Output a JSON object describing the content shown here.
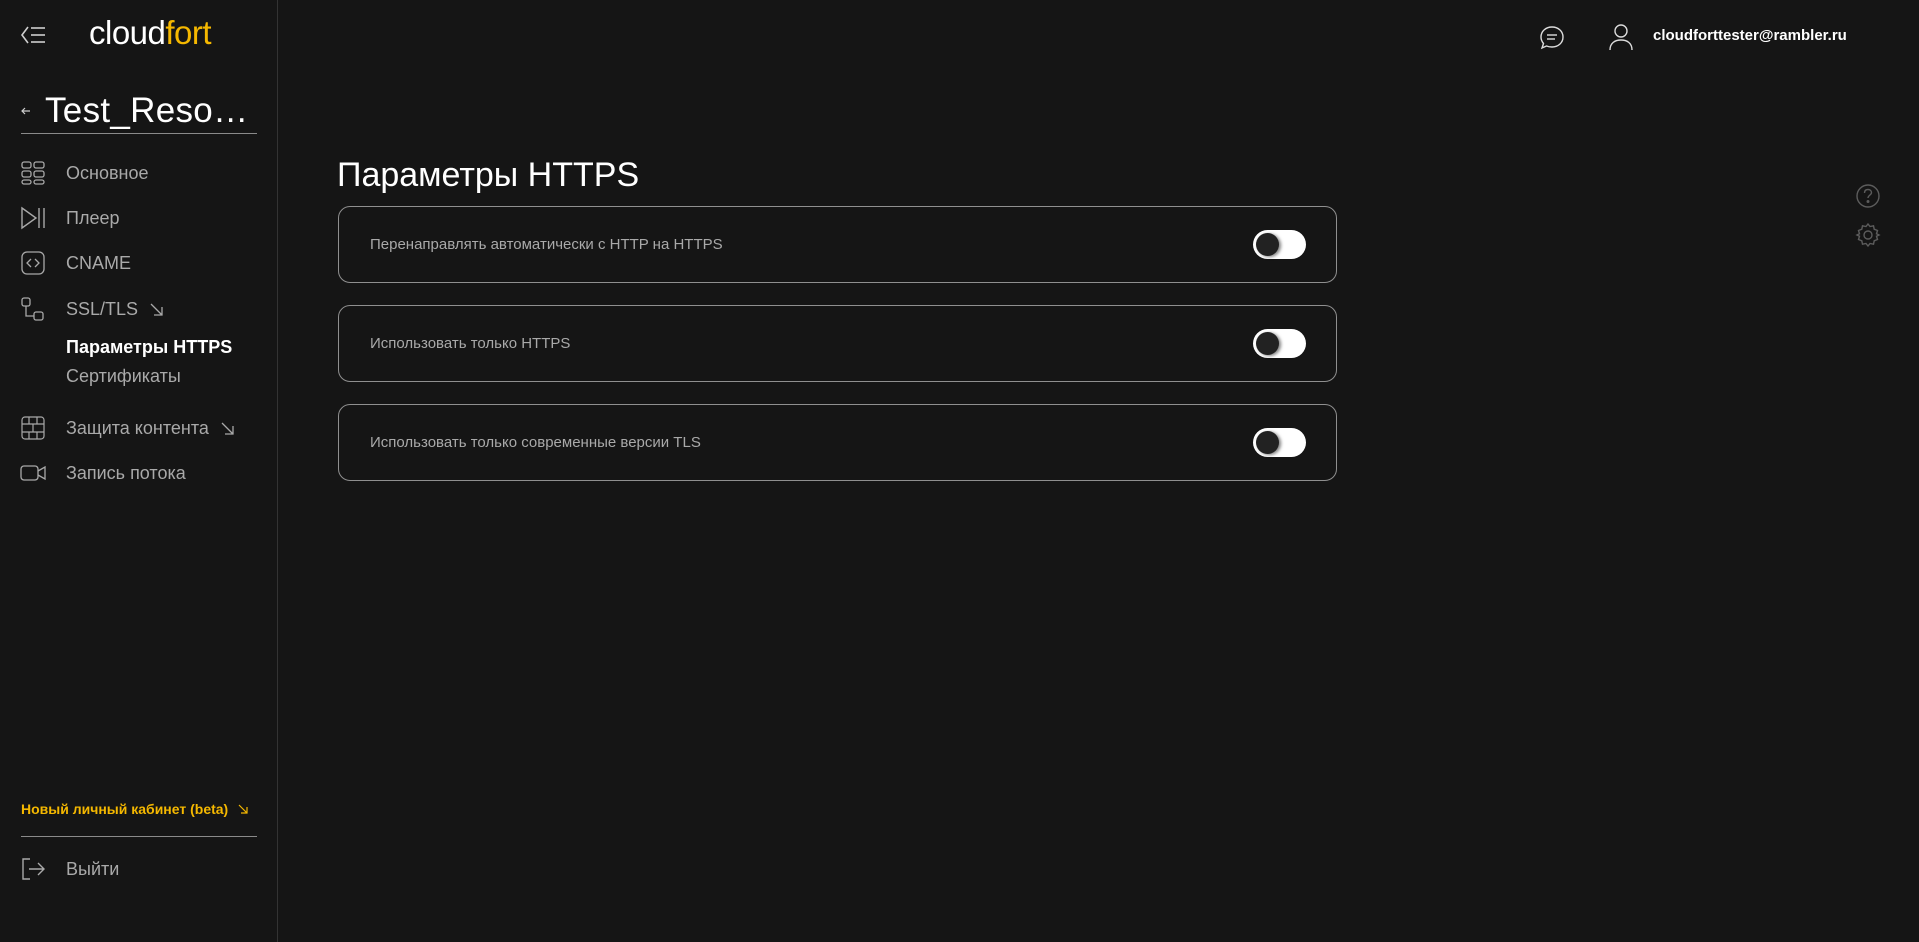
{
  "brand": {
    "part1": "cloud",
    "part2": "fort"
  },
  "resource": {
    "name": "Test_Resource"
  },
  "sidebar": {
    "items": [
      {
        "label": "Основное",
        "icon": "dashboard-grid-icon"
      },
      {
        "label": "Плеер",
        "icon": "play-pause-icon"
      },
      {
        "label": "CNAME",
        "icon": "code-brackets-icon"
      },
      {
        "label": "SSL/TLS",
        "icon": "nodes-link-icon",
        "expanded": true
      },
      {
        "label": "Защита контента",
        "icon": "firewall-brick-icon"
      },
      {
        "label": "Запись потока",
        "icon": "video-camera-icon"
      }
    ],
    "ssl_sub": [
      {
        "label": "Параметры HTTPS",
        "active": true
      },
      {
        "label": "Сертификаты",
        "active": false
      }
    ],
    "beta_link": "Новый личный кабинет (beta)",
    "logout": "Выйти"
  },
  "header": {
    "email": "cloudforttester@rambler.ru"
  },
  "main": {
    "title": "Параметры HTTPS",
    "settings": [
      {
        "label": "Перенаправлять автоматически с HTTP на HTTPS",
        "enabled": false
      },
      {
        "label": "Использовать только HTTPS",
        "enabled": false
      },
      {
        "label": "Использовать только современные версии TLS",
        "enabled": false
      }
    ]
  },
  "colors": {
    "accent": "#f5b800",
    "background": "#151515",
    "muted_text": "#a9a9a9"
  }
}
